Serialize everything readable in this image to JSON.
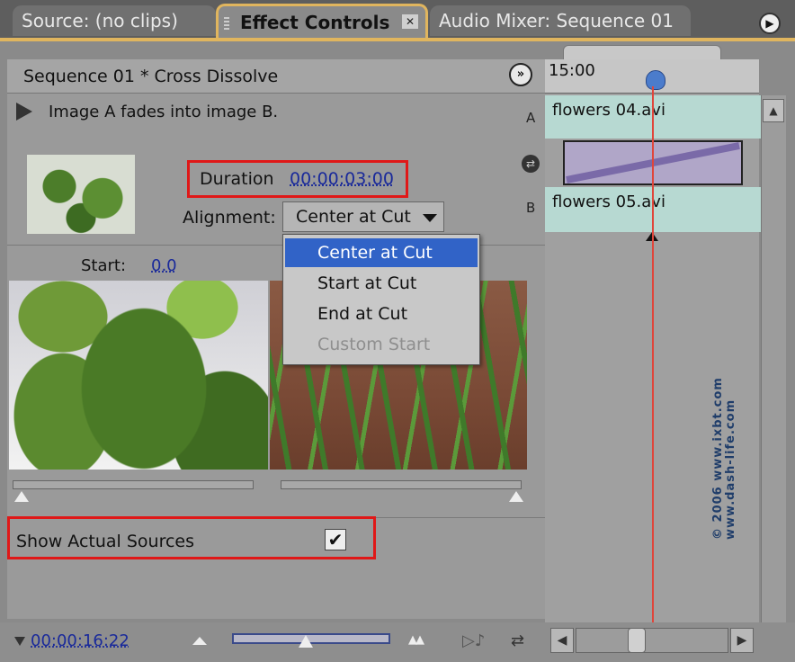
{
  "tabs": {
    "source": "Source: (no clips)",
    "effect_controls": "Effect Controls",
    "close_glyph": "✕",
    "audio_mixer": "Audio Mixer: Sequence 01"
  },
  "panel": {
    "title": "Sequence 01 * Cross Dissolve",
    "expand_glyph": "»",
    "description": "Image A fades into image B.",
    "track_a_label": "A",
    "track_b_label": "B",
    "duration_label": "Duration",
    "duration_value": "00:00:03:00",
    "alignment_label": "Alignment:",
    "alignment_value": "Center at Cut",
    "start_label": "Start:",
    "start_value": "0.0",
    "show_actual_sources_label": "Show Actual Sources",
    "show_actual_sources_checked": true,
    "check_glyph": "✔"
  },
  "alignment_options": [
    {
      "label": "Center at Cut",
      "selected": true,
      "enabled": true
    },
    {
      "label": "Start at Cut",
      "selected": false,
      "enabled": true
    },
    {
      "label": "End at Cut",
      "selected": false,
      "enabled": true
    },
    {
      "label": "Custom Start",
      "selected": false,
      "enabled": false
    }
  ],
  "timeline": {
    "time_label": "15:00",
    "clip_a": "flowers 04.avi",
    "clip_b": "flowers 05.avi"
  },
  "bottom": {
    "timecode": "00:00:16:22"
  },
  "watermark": {
    "line1": "© 2006 www.ixbt.com",
    "line2": "www.dash-life.com"
  },
  "colors": {
    "accent_tab_border": "#e0b55e",
    "highlight_box": "#e01818",
    "selection": "#3163c7",
    "timecode_blue": "#1a2a9a",
    "clip_fill": "#b7d9d2",
    "transition_fill": "#b0a6c8",
    "playhead": "#e0453a"
  },
  "icons": [
    "tab-grip-icon",
    "panel-menu-icon",
    "expand-timeline-icon",
    "play-triangle-icon",
    "transition-swap-icon",
    "dropdown-arrow-icon",
    "checkmark-icon",
    "zoom-out-icon",
    "zoom-in-icon",
    "audio-play-icon",
    "loop-icon",
    "scroll-left-icon",
    "scroll-right-icon",
    "scroll-up-icon",
    "playhead-icon",
    "cut-marker-icon"
  ]
}
